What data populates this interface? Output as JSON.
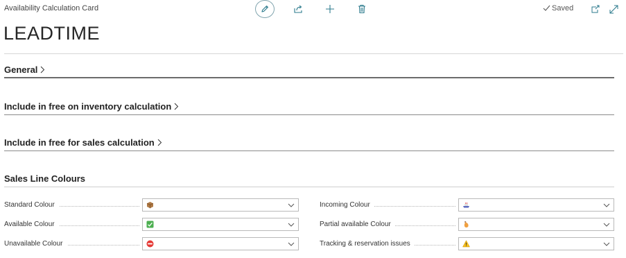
{
  "header": {
    "card_title": "Availability Calculation Card",
    "record_title": "LEADTIME",
    "status": "Saved"
  },
  "toolbar": {
    "icons": [
      "edit-icon",
      "share-icon",
      "add-icon",
      "delete-icon",
      "open-new-window-icon",
      "expand-icon"
    ]
  },
  "sections": {
    "general": "General",
    "inventory": "Include in free on inventory calculation",
    "sales": "Include in free for sales calculation",
    "colours": "Sales Line Colours"
  },
  "fields": {
    "standard": {
      "label": "Standard Colour",
      "icon": "brown-box-icon"
    },
    "available": {
      "label": "Available Colour",
      "icon": "green-check-icon"
    },
    "unavailable": {
      "label": "Unavailable Colour",
      "icon": "red-no-entry-icon"
    },
    "incoming": {
      "label": "Incoming Colour",
      "icon": "ship-icon"
    },
    "partial": {
      "label": "Partial available Colour",
      "icon": "orange-bottle-icon"
    },
    "tracking": {
      "label": "Tracking & reservation issues",
      "icon": "warning-icon"
    }
  },
  "colors": {
    "accent_ring": "#7fa3ad",
    "icon_teal": "#2b7a8c",
    "divider": "#d6d6d6"
  }
}
